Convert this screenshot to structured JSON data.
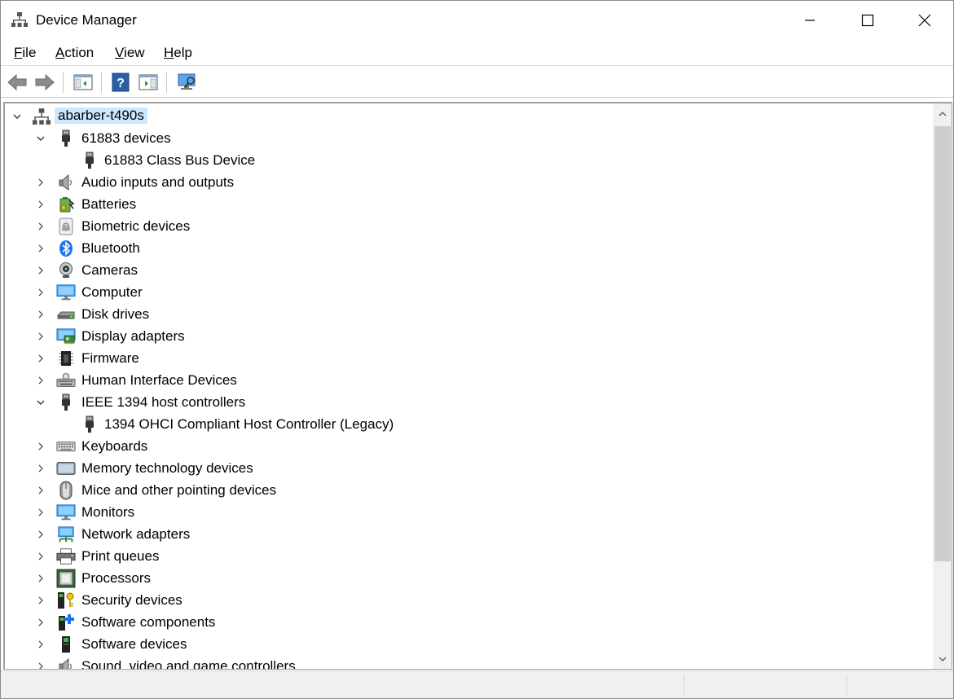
{
  "window": {
    "title": "Device Manager",
    "app_icon": "device-manager-icon"
  },
  "menu": {
    "items": [
      {
        "label": "File",
        "accel": "F",
        "rest": "ile"
      },
      {
        "label": "Action",
        "accel": "A",
        "rest": "ction"
      },
      {
        "label": "View",
        "accel": "V",
        "rest": "iew"
      },
      {
        "label": "Help",
        "accel": "H",
        "rest": "elp"
      }
    ]
  },
  "toolbar": {
    "buttons": [
      "back-arrow-icon",
      "forward-arrow-icon",
      "show-hide-console-tree-icon",
      "help-icon",
      "properties-icon",
      "scan-hardware-icon"
    ]
  },
  "tree": {
    "root": {
      "label": "abarber-t490s",
      "icon": "computer-network-icon",
      "expanded": true
    },
    "items": [
      {
        "label": "61883 devices",
        "icon": "usb-plug-icon",
        "level": 1,
        "expanded": true
      },
      {
        "label": "61883 Class Bus Device",
        "icon": "usb-plug-icon",
        "level": 2
      },
      {
        "label": "Audio inputs and outputs",
        "icon": "speaker-icon",
        "level": 1,
        "expanded": false
      },
      {
        "label": "Batteries",
        "icon": "battery-icon",
        "level": 1,
        "expanded": false
      },
      {
        "label": "Biometric devices",
        "icon": "fingerprint-icon",
        "level": 1,
        "expanded": false
      },
      {
        "label": "Bluetooth",
        "icon": "bluetooth-icon",
        "level": 1,
        "expanded": false
      },
      {
        "label": "Cameras",
        "icon": "webcam-icon",
        "level": 1,
        "expanded": false
      },
      {
        "label": "Computer",
        "icon": "monitor-icon",
        "level": 1,
        "expanded": false
      },
      {
        "label": "Disk drives",
        "icon": "disk-drive-icon",
        "level": 1,
        "expanded": false
      },
      {
        "label": "Display adapters",
        "icon": "display-adapter-icon",
        "level": 1,
        "expanded": false
      },
      {
        "label": "Firmware",
        "icon": "chip-icon",
        "level": 1,
        "expanded": false
      },
      {
        "label": "Human Interface Devices",
        "icon": "hid-icon",
        "level": 1,
        "expanded": false
      },
      {
        "label": "IEEE 1394 host controllers",
        "icon": "usb-plug-icon",
        "level": 1,
        "expanded": true
      },
      {
        "label": "1394 OHCI Compliant Host Controller (Legacy)",
        "icon": "usb-plug-icon",
        "level": 2
      },
      {
        "label": "Keyboards",
        "icon": "keyboard-icon",
        "level": 1,
        "expanded": false
      },
      {
        "label": "Memory technology devices",
        "icon": "memory-card-icon",
        "level": 1,
        "expanded": false
      },
      {
        "label": "Mice and other pointing devices",
        "icon": "mouse-icon",
        "level": 1,
        "expanded": false
      },
      {
        "label": "Monitors",
        "icon": "monitor-icon",
        "level": 1,
        "expanded": false
      },
      {
        "label": "Network adapters",
        "icon": "network-adapter-icon",
        "level": 1,
        "expanded": false
      },
      {
        "label": "Print queues",
        "icon": "printer-icon",
        "level": 1,
        "expanded": false
      },
      {
        "label": "Processors",
        "icon": "processor-icon",
        "level": 1,
        "expanded": false
      },
      {
        "label": "Security devices",
        "icon": "security-key-icon",
        "level": 1,
        "expanded": false
      },
      {
        "label": "Software components",
        "icon": "software-component-icon",
        "level": 1,
        "expanded": false
      },
      {
        "label": "Software devices",
        "icon": "software-device-icon",
        "level": 1,
        "expanded": false
      },
      {
        "label": "Sound, video and game controllers",
        "icon": "speaker-icon",
        "level": 1,
        "expanded": false
      }
    ]
  },
  "colors": {
    "selection": "#cce8ff",
    "scroll_thumb": "#cdcdcd",
    "status_bg": "#f0f0f0"
  }
}
